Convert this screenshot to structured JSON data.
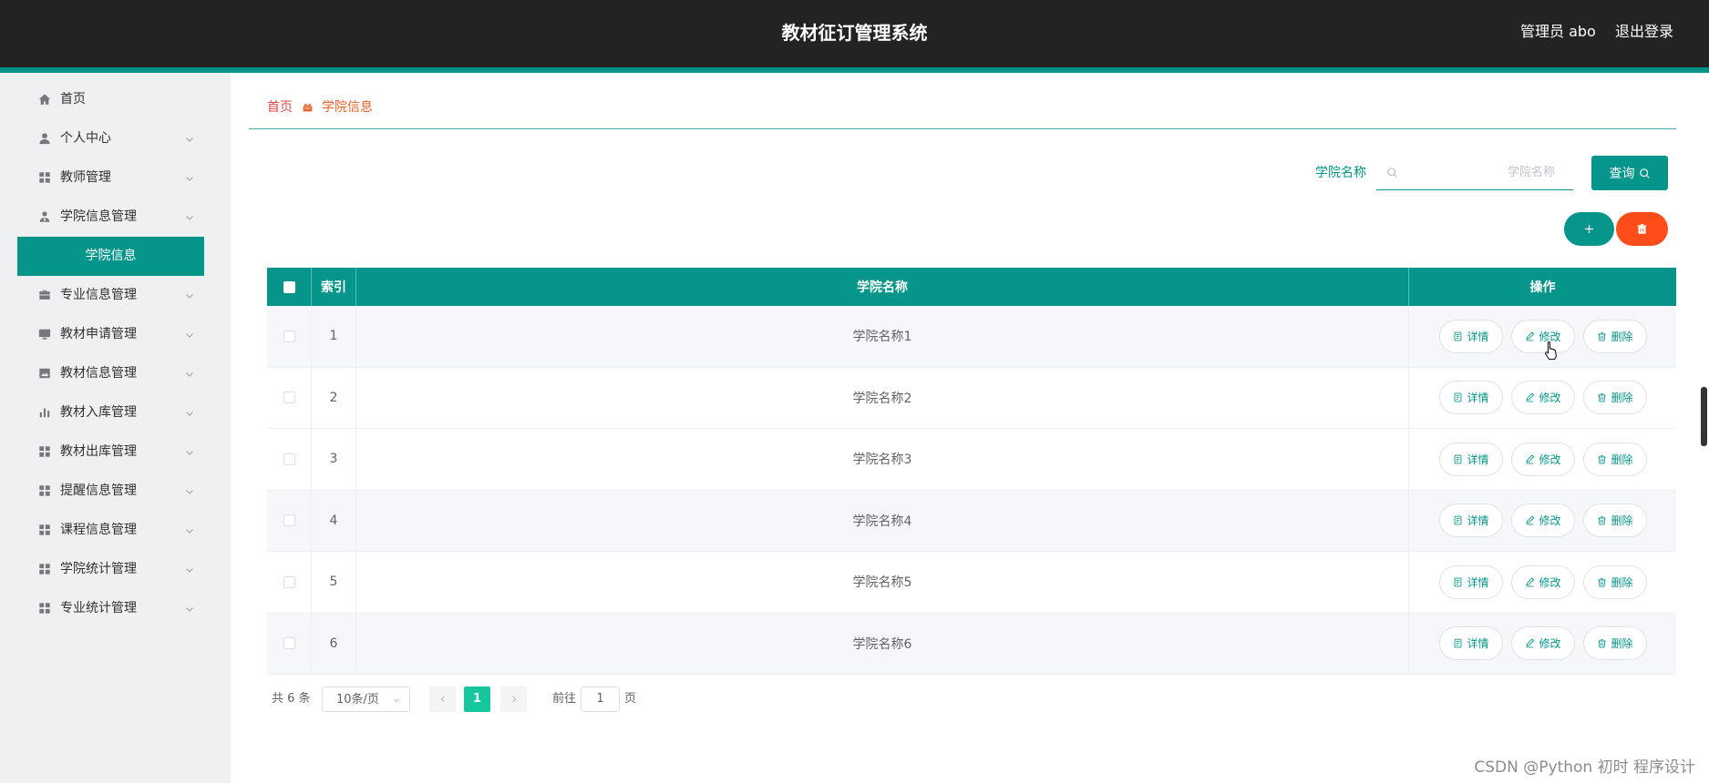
{
  "header": {
    "title": "教材征订管理系统",
    "user_label": "管理员 abo",
    "logout_label": "退出登录"
  },
  "sidebar": {
    "items": [
      {
        "label": "首页",
        "icon": "home"
      },
      {
        "label": "个人中心",
        "icon": "user",
        "expandable": true
      },
      {
        "label": "教师管理",
        "icon": "grid",
        "expandable": true
      },
      {
        "label": "学院信息管理",
        "icon": "user-badge",
        "expandable": true,
        "expanded": true,
        "children": [
          {
            "label": "学院信息",
            "active": true
          }
        ]
      },
      {
        "label": "专业信息管理",
        "icon": "briefcase",
        "expandable": true
      },
      {
        "label": "教材申请管理",
        "icon": "monitor",
        "expandable": true
      },
      {
        "label": "教材信息管理",
        "icon": "chart-square",
        "expandable": true
      },
      {
        "label": "教材入库管理",
        "icon": "bar-chart",
        "expandable": true
      },
      {
        "label": "教材出库管理",
        "icon": "grid",
        "expandable": true
      },
      {
        "label": "提醒信息管理",
        "icon": "grid",
        "expandable": true
      },
      {
        "label": "课程信息管理",
        "icon": "grid",
        "expandable": true
      },
      {
        "label": "学院统计管理",
        "icon": "grid",
        "expandable": true
      },
      {
        "label": "专业统计管理",
        "icon": "grid",
        "expandable": true
      }
    ]
  },
  "breadcrumb": {
    "home_label": "首页",
    "separator_icon": "crown",
    "current_label": "学院信息"
  },
  "search": {
    "label": "学院名称",
    "placeholder": "学院名称",
    "icon": "search",
    "button_label": "查询",
    "button_icon": "search"
  },
  "toolbar": {
    "add_icon": "plus",
    "delete_icon": "trash"
  },
  "table": {
    "columns": [
      "索引",
      "学院名称",
      "操作"
    ],
    "rows": [
      {
        "index": "1",
        "name": "学院名称1"
      },
      {
        "index": "2",
        "name": "学院名称2"
      },
      {
        "index": "3",
        "name": "学院名称3"
      },
      {
        "index": "4",
        "name": "学院名称4"
      },
      {
        "index": "5",
        "name": "学院名称5"
      },
      {
        "index": "6",
        "name": "学院名称6"
      }
    ],
    "actions": {
      "detail_label": "详情",
      "edit_label": "修改",
      "delete_label": "删除"
    }
  },
  "pagination": {
    "total_text": "共 6 条",
    "page_size": "10条/页",
    "current_page": "1",
    "goto_label": "前往",
    "goto_value": "1",
    "page_suffix": "页"
  },
  "watermark": "CSDN @Python 初时 程序设计",
  "colors": {
    "primary": "#05958a",
    "header_bg": "#232326",
    "danger": "#ff4d19",
    "pager_active": "#16c69d",
    "breadcrumb_home": "#e0494b",
    "breadcrumb_current": "#e8612c"
  }
}
